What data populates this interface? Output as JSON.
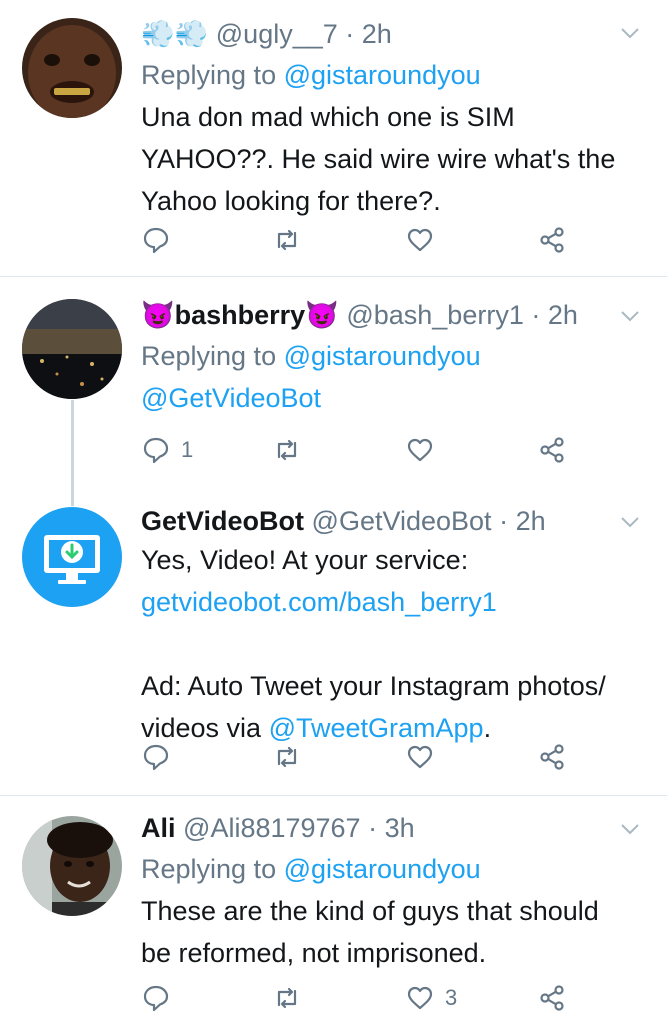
{
  "tweets": [
    {
      "emoji": "💨💨",
      "handle": "@ugly__7",
      "time": "· 2h",
      "replying_label": "Replying to",
      "replying_to": "@gistaroundyou",
      "lines": [
        "Una don mad which one is SIM",
        "YAHOO??.  He said wire wire what's the",
        "Yahoo looking for there?."
      ],
      "reply_count": "",
      "like_count": ""
    },
    {
      "name_prefix_emoji": "😈",
      "name": "bashberry",
      "name_suffix_emoji": "😈",
      "handle": "@bash_berry1",
      "time": "· 2h",
      "replying_label": "Replying to",
      "replying_to": "@gistaroundyou",
      "mention": "@GetVideoBot",
      "reply_count": "1",
      "like_count": ""
    },
    {
      "name": "GetVideoBot",
      "handle": "@GetVideoBot",
      "time": "· 2h",
      "line1": "Yes, Video! At your service:",
      "link": "getvideobot.com/bash_berry1",
      "ad_line1": "Ad: Auto Tweet your Instagram photos/",
      "ad_line2_prefix": "videos via ",
      "ad_mention": "@TweetGramApp",
      "ad_line2_suffix": ".",
      "reply_count": "",
      "like_count": ""
    },
    {
      "name": "Ali",
      "handle": "@Ali88179767",
      "time": "· 3h",
      "replying_label": "Replying to",
      "replying_to": "@gistaroundyou",
      "lines": [
        "These are the kind of guys that should",
        "be reformed, not imprisoned."
      ],
      "reply_count": "",
      "like_count": "3"
    }
  ],
  "colors": {
    "link": "#1da1f2",
    "muted": "#657786",
    "text": "#14171a",
    "divider": "#e1e8ed",
    "bot_avatar": "#1da1f2"
  }
}
